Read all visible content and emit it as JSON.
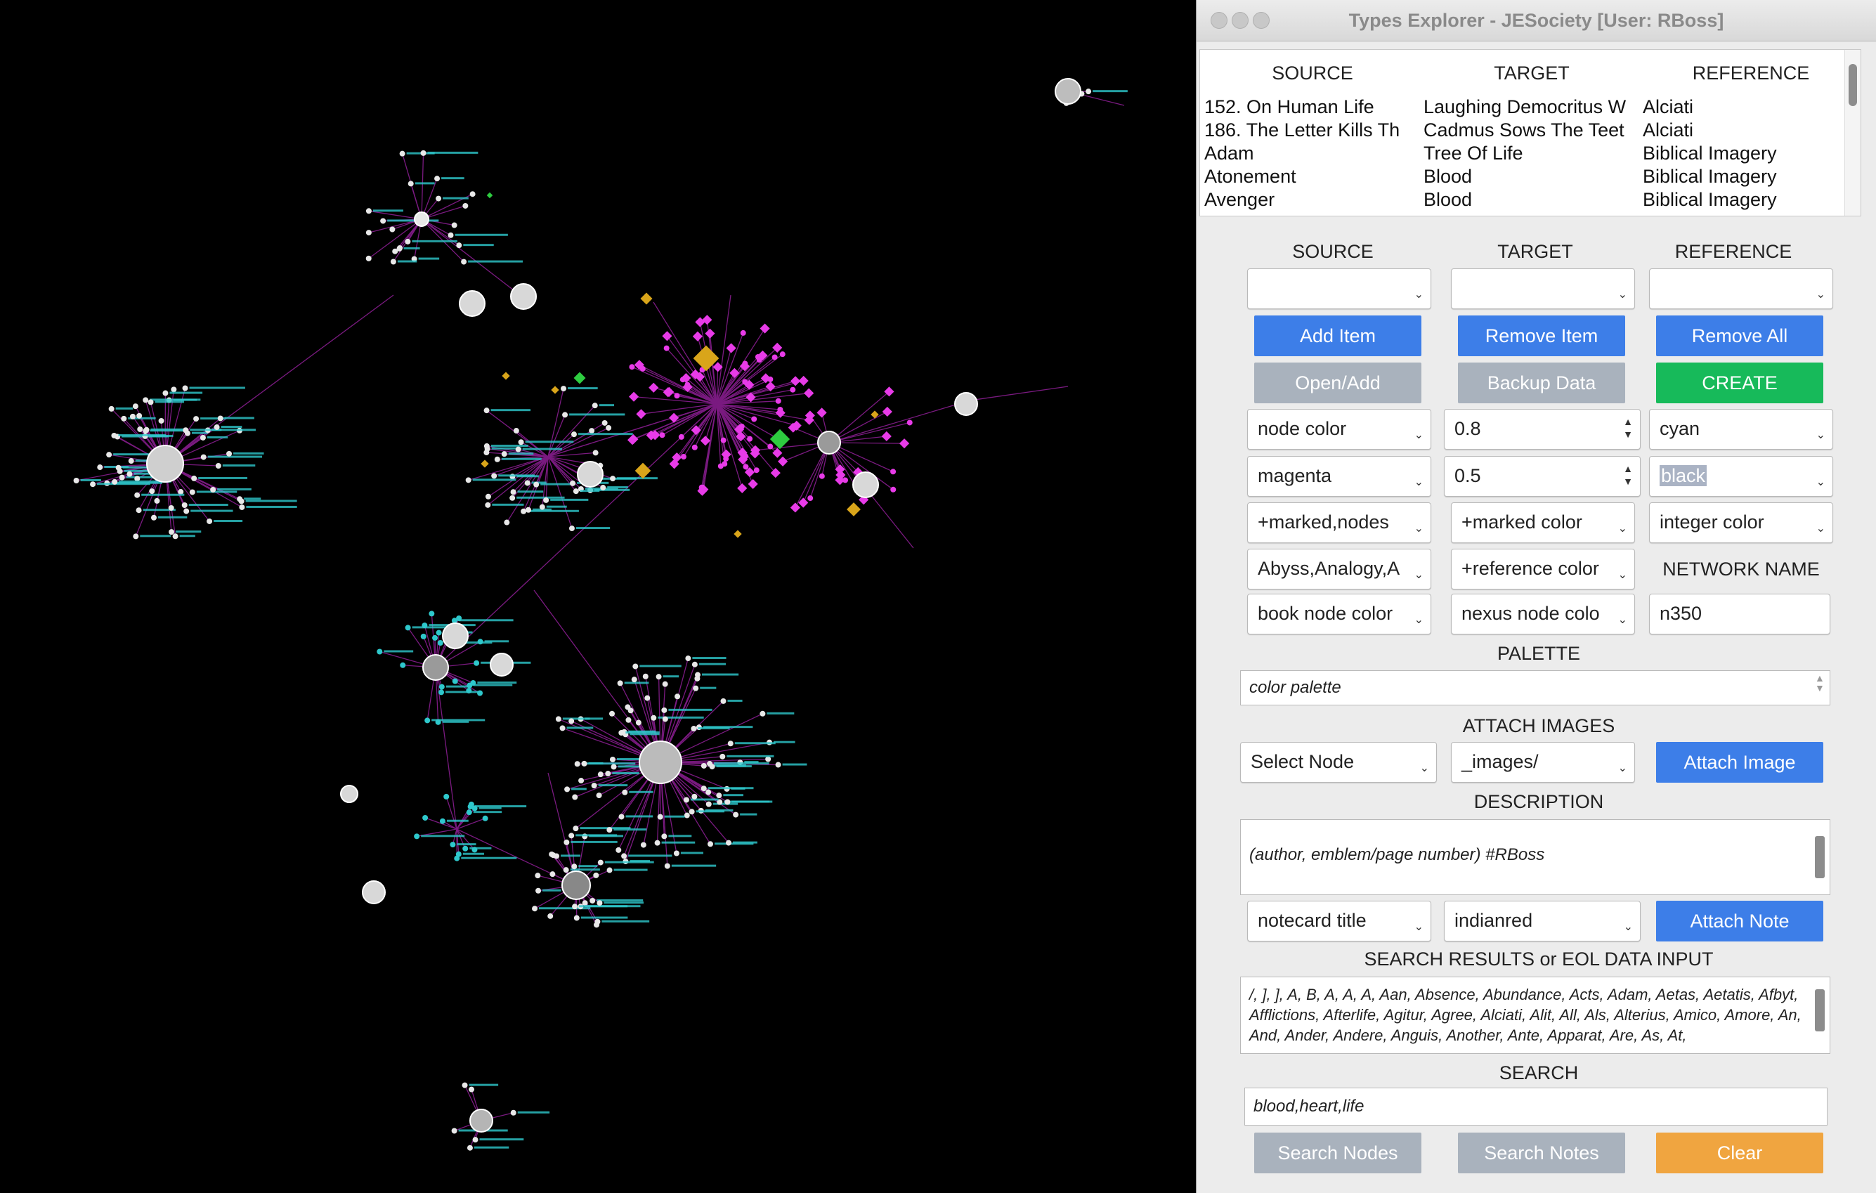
{
  "window": {
    "title": "Types Explorer - JESociety [User: RBoss]"
  },
  "table": {
    "headers": [
      "SOURCE",
      "TARGET",
      "REFERENCE"
    ],
    "rows": [
      [
        "152. On Human Life",
        "Laughing Democritus W",
        "Alciati"
      ],
      [
        "186. The Letter Kills Th",
        "Cadmus Sows The Teet",
        "Alciati"
      ],
      [
        "Adam",
        "Tree Of Life",
        "Biblical Imagery"
      ],
      [
        "Atonement",
        "Blood",
        "Biblical Imagery"
      ],
      [
        "Avenger",
        "Blood",
        "Biblical Imagery"
      ]
    ]
  },
  "form": {
    "source_label": "SOURCE",
    "target_label": "TARGET",
    "reference_label": "REFERENCE",
    "source_value": "",
    "target_value": "",
    "reference_value": "",
    "add_item": "Add Item",
    "remove_item": "Remove Item",
    "remove_all": "Remove All",
    "open_add": "Open/Add",
    "backup_data": "Backup Data",
    "create": "CREATE",
    "node_color": "node color",
    "spin1": "0.8",
    "cyan": "cyan",
    "magenta": "magenta",
    "spin2": "0.5",
    "black": "black",
    "marked_nodes": "+marked,nodes",
    "marked_color": "+marked color",
    "integer_color": "integer color",
    "abyss": "Abyss,Analogy,A",
    "reference_color": "+reference color",
    "network_name_label": "NETWORK NAME",
    "book_node_color": "book node color",
    "nexus_node_color": "nexus node colo",
    "network_name": "n350",
    "palette_label": "PALETTE",
    "palette_value": "color palette",
    "attach_images_label": "ATTACH IMAGES",
    "select_node": "Select Node",
    "images_dir": "_images/",
    "attach_image": "Attach Image",
    "description_label": "DESCRIPTION",
    "description_value": "(author, emblem/page number) #RBoss",
    "notecard_title": "notecard title",
    "note_color": "indianred",
    "attach_note": "Attach Note",
    "search_results_label": "SEARCH RESULTS or EOL DATA INPUT",
    "search_results": "/, ], ], A, B, A, A, A, Aan, Absence, Abundance, Acts, Adam, Aetas, Aetatis, Afbyt, Afflictions, Afterlife, Agitur, Agree, Alciati, Alit, All, Als, Alterius, Amico, Amore, An, And, Ander, Andere, Anguis, Another, Ante, Apparat, Are, As, At,",
    "search_label": "SEARCH",
    "search_value": "blood,heart,life",
    "search_nodes": "Search Nodes",
    "search_notes": "Search Notes",
    "clear": "Clear"
  },
  "colors": {
    "graph_bg": "#000000",
    "edge": "#7a1a80",
    "hub": "#e83be8",
    "cyan": "#2ec8cc",
    "gold": "#d9a51a",
    "green": "#2ecc40",
    "node": "#e8e8e8"
  }
}
